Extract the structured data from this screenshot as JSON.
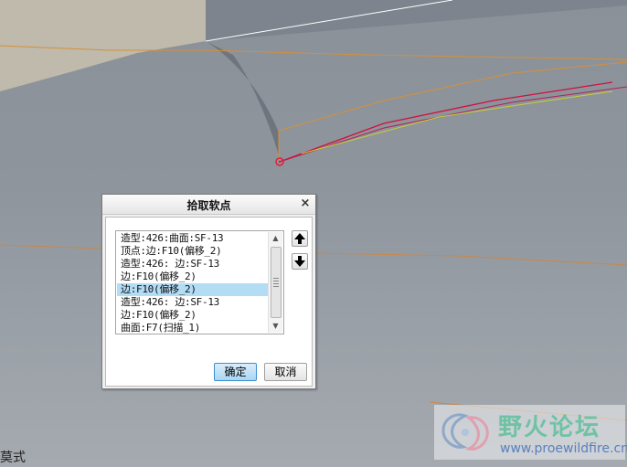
{
  "dialog": {
    "title": "拾取软点",
    "close_label": "×",
    "list_items": [
      "造型:426:曲面:SF-13",
      "顶点:边:F10(偏移_2)",
      "造型:426: 边:SF-13",
      "边:F10(偏移_2)",
      "边:F10(偏移_2)",
      "造型:426: 边:SF-13",
      "边:F10(偏移_2)",
      "曲面:F7(扫描_1)"
    ],
    "selected_index": 4,
    "move_up_label": "🡅",
    "move_down_label": "🡇",
    "ok_label": "确定",
    "cancel_label": "取消"
  },
  "status_bar": {
    "text": "莫式"
  },
  "watermark": {
    "name": "野火论坛",
    "url": "www.proewildfire.cn"
  },
  "colors": {
    "selection": "#b3dcf5",
    "ok_border": "#3c8fd0",
    "point_marker": "#e0203a"
  }
}
